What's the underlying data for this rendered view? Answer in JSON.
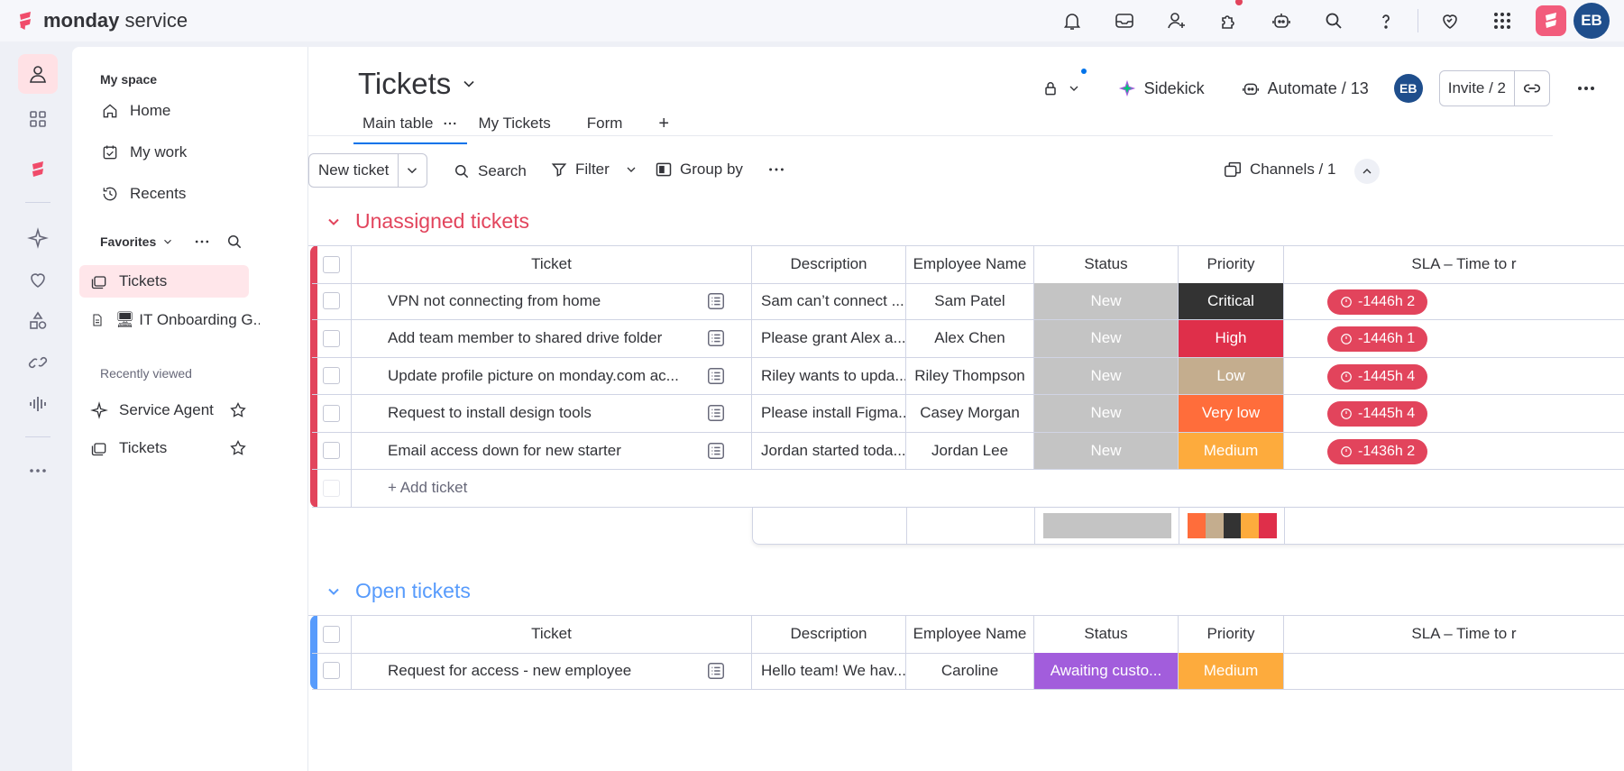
{
  "app": {
    "brand_bold": "monday",
    "brand_light": " service",
    "avatar_initials": "EB"
  },
  "top_icons": [
    "bell-icon",
    "inbox-icon",
    "invite-member-icon",
    "apps-icon",
    "ai-robot-icon",
    "search-icon",
    "help-icon",
    "heart-icon",
    "grid-icon"
  ],
  "sidebar": {
    "title": "My space",
    "nav": [
      {
        "label": "Home",
        "icon": "home-icon"
      },
      {
        "label": "My work",
        "icon": "my-work-icon"
      },
      {
        "label": "Recents",
        "icon": "recents-icon"
      }
    ],
    "favorites_label": "Favorites",
    "favorites": [
      {
        "label": "Tickets",
        "icon": "board-icon"
      },
      {
        "label": "🖥 IT Onboarding G...",
        "icon": "doc-icon"
      }
    ],
    "recent_label": "Recently viewed",
    "recent": [
      {
        "label": "Service Agent",
        "icon": "sparkle-icon"
      },
      {
        "label": "Tickets",
        "icon": "board-icon"
      }
    ]
  },
  "board": {
    "title": "Tickets",
    "sidekick": "Sidekick",
    "automate": "Automate / 13",
    "invite": "Invite / 2",
    "tabs": [
      "Main table",
      "My Tickets",
      "Form"
    ],
    "toolbar": {
      "new_ticket": "New ticket",
      "search": "Search",
      "filter": "Filter",
      "group_by": "Group by",
      "channels": "Channels / 1"
    },
    "columns": [
      "Ticket",
      "Description",
      "Employee Name",
      "Status",
      "Priority",
      "SLA – Time to r"
    ],
    "groups": [
      {
        "title": "Unassigned tickets",
        "color": "#e2445c",
        "add_label": "+ Add ticket",
        "rows": [
          {
            "ticket": "VPN not connecting from home",
            "description": "Sam can’t connect ...",
            "employee": "Sam Patel",
            "status": "New",
            "priority": "Critical",
            "priority_color": "#333333",
            "sla": "-1446h 2"
          },
          {
            "ticket": "Add team member to shared drive folder",
            "description": "Please grant Alex a...",
            "employee": "Alex Chen",
            "status": "New",
            "priority": "High",
            "priority_color": "#df2f4a",
            "sla": "-1446h 1"
          },
          {
            "ticket": "Update profile picture on monday.com ac...",
            "description": "Riley wants to upda...",
            "employee": "Riley Thompson",
            "status": "New",
            "priority": "Low",
            "priority_color": "#c4ad8e",
            "sla": "-1445h 4"
          },
          {
            "ticket": "Request to install design tools",
            "description": "Please install Figma...",
            "employee": "Casey Morgan",
            "status": "New",
            "priority": "Very low",
            "priority_color": "#ff6d3b",
            "sla": "-1445h 4"
          },
          {
            "ticket": "Email access down for new starter",
            "description": "Jordan started toda...",
            "employee": "Jordan Lee",
            "status": "New",
            "priority": "Medium",
            "priority_color": "#fdab3d",
            "sla": "-1436h 2"
          }
        ],
        "summary_priority_colors": [
          "#ff6d3b",
          "#c4ad8e",
          "#333333",
          "#fdab3d",
          "#df2f4a"
        ]
      },
      {
        "title": "Open tickets",
        "color": "#579bfc",
        "rows": [
          {
            "ticket": "Request for access - new employee",
            "description": "Hello team! We hav...",
            "employee": "Caroline",
            "status": "Awaiting custo...",
            "status_color": "#a25ddc",
            "priority": "Medium",
            "priority_color": "#fdab3d"
          }
        ]
      }
    ],
    "status_new_color": "#c4c4c4"
  }
}
